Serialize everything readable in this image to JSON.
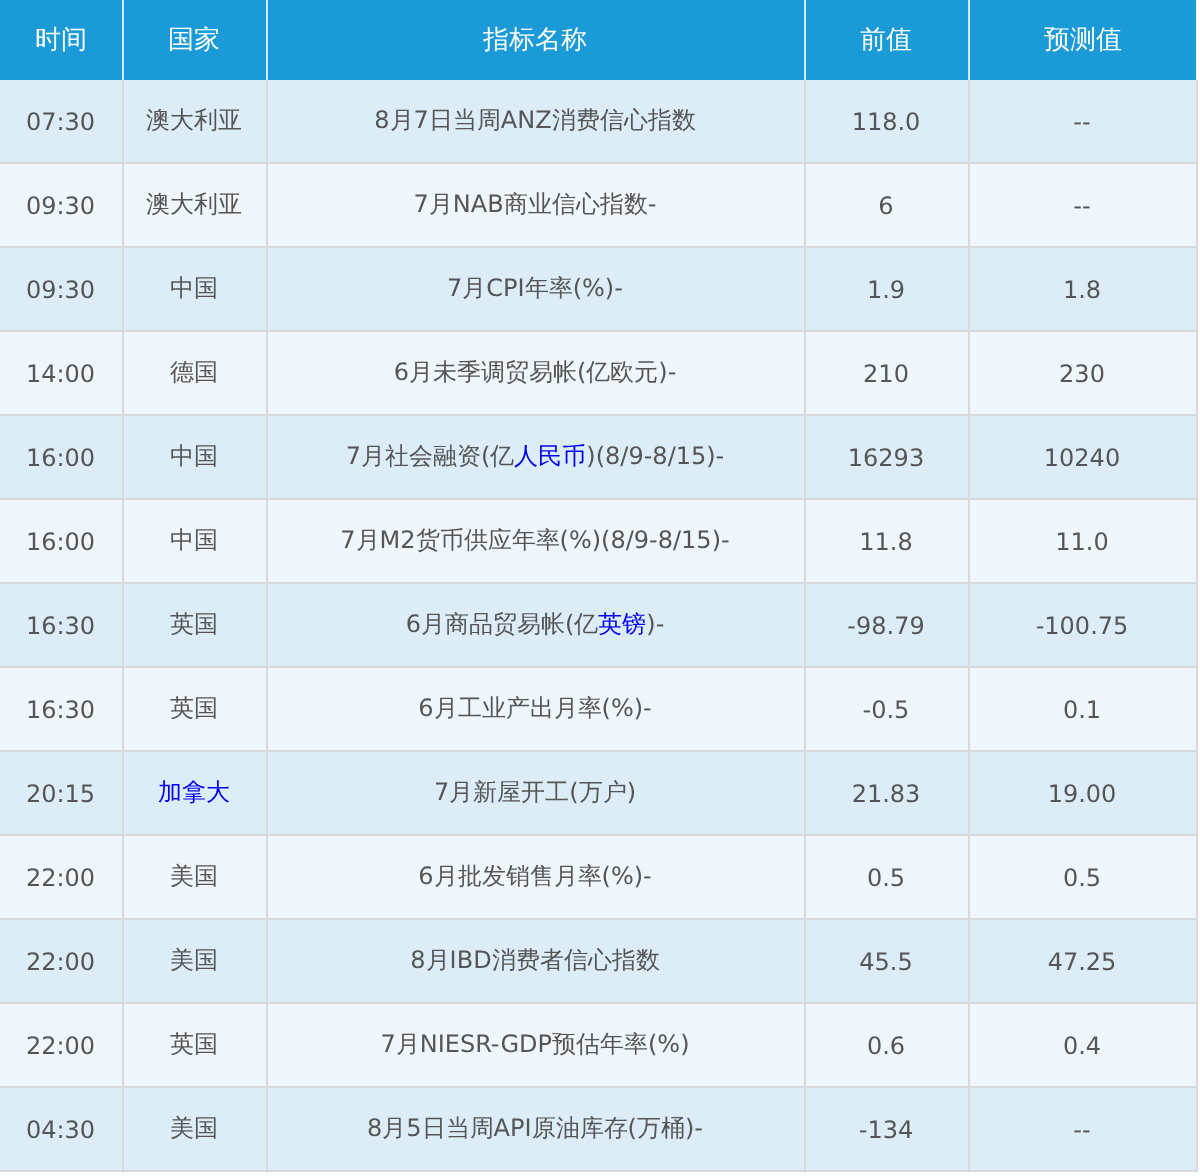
{
  "columns": [
    "时间",
    "国家",
    "指标名称",
    "前值",
    "预测值"
  ],
  "rows": [
    {
      "time": "07:30",
      "country": {
        "text": "澳大利亚",
        "link": false
      },
      "indicator": [
        {
          "text": "8月7日当周ANZ消费信心指数",
          "link": false
        }
      ],
      "previous": "118.0",
      "forecast": "--"
    },
    {
      "time": "09:30",
      "country": {
        "text": "澳大利亚",
        "link": false
      },
      "indicator": [
        {
          "text": "7月NAB商业信心指数-",
          "link": false
        }
      ],
      "previous": "6",
      "forecast": "--"
    },
    {
      "time": "09:30",
      "country": {
        "text": "中国",
        "link": false
      },
      "indicator": [
        {
          "text": "7月CPI年率(%)-",
          "link": false
        }
      ],
      "previous": "1.9",
      "forecast": "1.8"
    },
    {
      "time": "14:00",
      "country": {
        "text": "德国",
        "link": false
      },
      "indicator": [
        {
          "text": "6月未季调贸易帐(亿欧元)-",
          "link": false
        }
      ],
      "previous": "210",
      "forecast": "230"
    },
    {
      "time": "16:00",
      "country": {
        "text": "中国",
        "link": false
      },
      "indicator": [
        {
          "text": "7月社会融资(亿",
          "link": false
        },
        {
          "text": "人民币",
          "link": true
        },
        {
          "text": ")(8/9-8/15)-",
          "link": false
        }
      ],
      "previous": "16293",
      "forecast": "10240"
    },
    {
      "time": "16:00",
      "country": {
        "text": "中国",
        "link": false
      },
      "indicator": [
        {
          "text": "7月M2货币供应年率(%)(8/9-8/15)-",
          "link": false
        }
      ],
      "previous": "11.8",
      "forecast": "11.0"
    },
    {
      "time": "16:30",
      "country": {
        "text": "英国",
        "link": false
      },
      "indicator": [
        {
          "text": "6月商品贸易帐(亿",
          "link": false
        },
        {
          "text": "英镑",
          "link": true
        },
        {
          "text": ")-",
          "link": false
        }
      ],
      "previous": "-98.79",
      "forecast": "-100.75"
    },
    {
      "time": "16:30",
      "country": {
        "text": "英国",
        "link": false
      },
      "indicator": [
        {
          "text": "6月工业产出月率(%)-",
          "link": false
        }
      ],
      "previous": "-0.5",
      "forecast": "0.1"
    },
    {
      "time": "20:15",
      "country": {
        "text": "加拿大",
        "link": true
      },
      "indicator": [
        {
          "text": "7月新屋开工(万户)",
          "link": false
        }
      ],
      "previous": "21.83",
      "forecast": "19.00"
    },
    {
      "time": "22:00",
      "country": {
        "text": "美国",
        "link": false
      },
      "indicator": [
        {
          "text": "6月批发销售月率(%)-",
          "link": false
        }
      ],
      "previous": "0.5",
      "forecast": "0.5"
    },
    {
      "time": "22:00",
      "country": {
        "text": "美国",
        "link": false
      },
      "indicator": [
        {
          "text": "8月IBD消费者信心指数",
          "link": false
        }
      ],
      "previous": "45.5",
      "forecast": "47.25"
    },
    {
      "time": "22:00",
      "country": {
        "text": "英国",
        "link": false
      },
      "indicator": [
        {
          "text": "7月NIESR-GDP预估年率(%)",
          "link": false
        }
      ],
      "previous": "0.6",
      "forecast": "0.4"
    },
    {
      "time": "04:30",
      "country": {
        "text": "美国",
        "link": false
      },
      "indicator": [
        {
          "text": "8月5日当周API原油库存(万桶)-",
          "link": false
        }
      ],
      "previous": "-134",
      "forecast": "--"
    }
  ]
}
